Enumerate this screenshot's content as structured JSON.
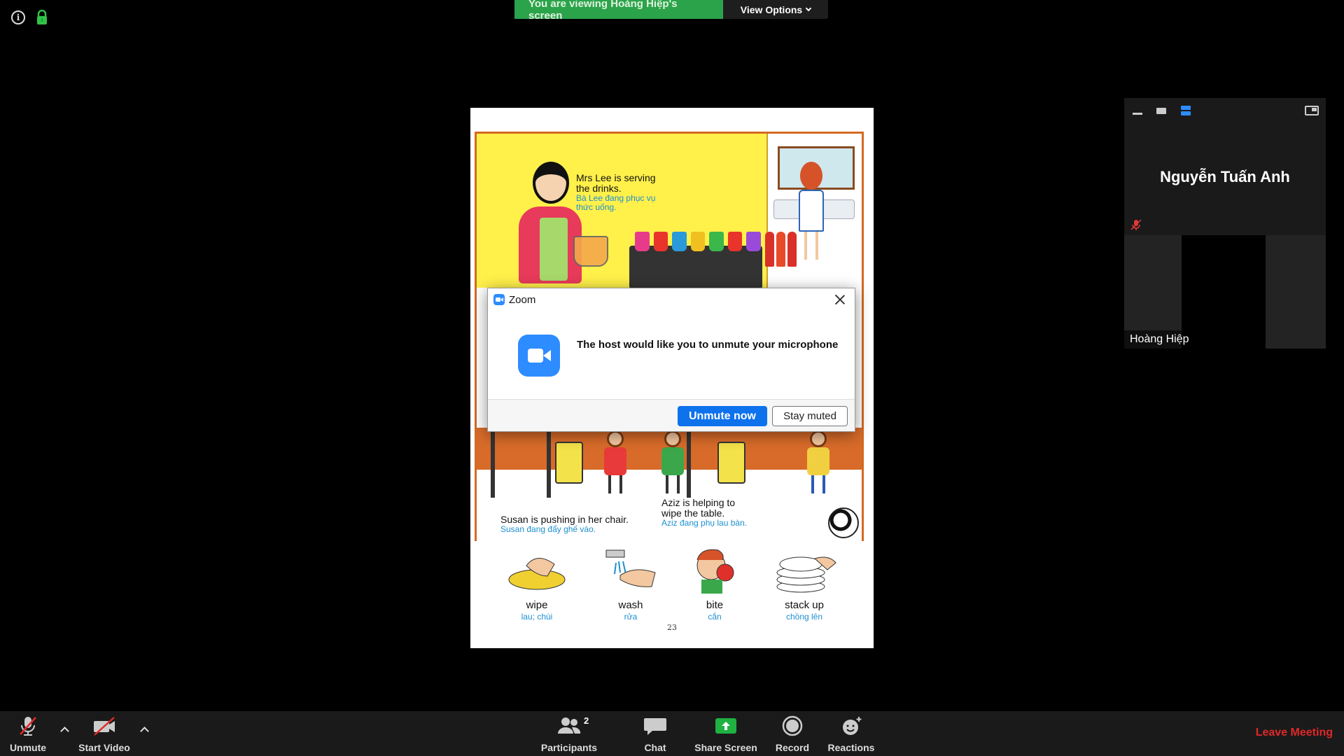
{
  "banner": {
    "viewing_text": "You are viewing Hoàng Hiệp's screen",
    "view_options": "View Options"
  },
  "document": {
    "captions": {
      "lee_en_1": "Mrs Lee is serving",
      "lee_en_2": "the drinks.",
      "lee_vi_1": "Bà Lee đang phục vụ",
      "lee_vi_2": "thức uống.",
      "susan_en": "Susan is pushing in her chair.",
      "susan_vi": "Susan đang đẩy ghế vào.",
      "aziz_en_1": "Aziz is helping to",
      "aziz_en_2": "wipe the table.",
      "aziz_vi": "Aziz đang phụ lau bàn."
    },
    "vocab": [
      {
        "word": "wipe",
        "translation": "lau; chùi"
      },
      {
        "word": "wash",
        "translation": "rửa"
      },
      {
        "word": "bite",
        "translation": "cắn"
      },
      {
        "word": "stack up",
        "translation": "chồng lên"
      }
    ],
    "page_number": "23"
  },
  "dialog": {
    "title": "Zoom",
    "message": "The host would like you to unmute your microphone",
    "primary_button": "Unmute now",
    "secondary_button": "Stay muted"
  },
  "panel": {
    "participant_name": "Nguyễn Tuấn Anh",
    "video_tile_name": "Hoàng Hiệp"
  },
  "toolbar": {
    "unmute": "Unmute",
    "start_video": "Start Video",
    "participants": "Participants",
    "participants_count": "2",
    "chat": "Chat",
    "share_screen": "Share Screen",
    "record": "Record",
    "reactions": "Reactions",
    "leave": "Leave Meeting"
  },
  "colors": {
    "banner_green": "#2ba34a",
    "zoom_blue": "#2d8cff",
    "primary_blue": "#0e72ed",
    "leave_red": "#e02828",
    "share_green": "#1fb141"
  }
}
